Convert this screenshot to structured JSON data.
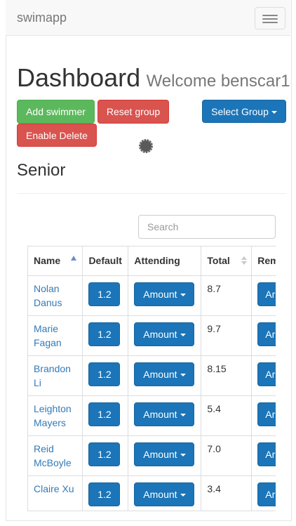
{
  "navbar": {
    "brand": "swimapp",
    "toggle_icon": "hamburger-icon"
  },
  "header": {
    "title": "Dashboard",
    "welcome": "Welcome benscar1"
  },
  "actions": {
    "add_swimmer": "Add swimmer",
    "reset_group": "Reset group",
    "select_group": "Select Group",
    "enable_delete": "Enable Delete"
  },
  "group": {
    "name": "Senior"
  },
  "search": {
    "placeholder": "Search",
    "value": ""
  },
  "table": {
    "columns": [
      "Name",
      "Default",
      "Attending",
      "Total",
      "Rem"
    ],
    "rows": [
      {
        "name": "Nolan Danus",
        "default": "1.2",
        "attending": "Amount",
        "total": "8.7",
        "rem": "Ar"
      },
      {
        "name": "Marie Fagan",
        "default": "1.2",
        "attending": "Amount",
        "total": "9.7",
        "rem": "Ar"
      },
      {
        "name": "Brandon Li",
        "default": "1.2",
        "attending": "Amount",
        "total": "8.15",
        "rem": "Ar"
      },
      {
        "name": "Leighton Mayers",
        "default": "1.2",
        "attending": "Amount",
        "total": "5.4",
        "rem": "Ar"
      },
      {
        "name": "Reid McBoyle",
        "default": "1.2",
        "attending": "Amount",
        "total": "7.0",
        "rem": "Ar"
      },
      {
        "name": "Claire Xu",
        "default": "1.2",
        "attending": "Amount",
        "total": "3.4",
        "rem": "Ar"
      }
    ]
  },
  "colors": {
    "success": "#5cb85c",
    "danger": "#d9534f",
    "primary": "#1b75b8",
    "link": "#337ab7"
  }
}
